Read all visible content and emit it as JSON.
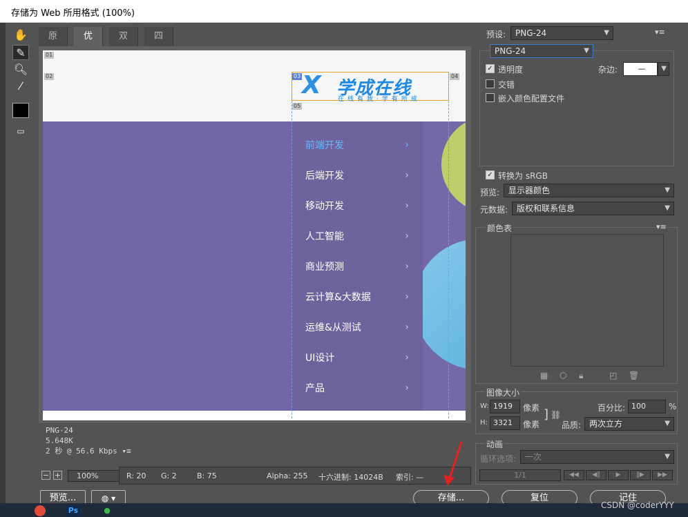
{
  "window": {
    "title": "存储为 Web 所用格式 (100%)"
  },
  "tabs": [
    {
      "label": "原稿"
    },
    {
      "label": "优化"
    },
    {
      "label": "双联"
    },
    {
      "label": "四联"
    }
  ],
  "canvas": {
    "slices": [
      "01",
      "02",
      "03",
      "04",
      "05"
    ],
    "logo": {
      "main": "学成在线",
      "sub": "在线有我·学有所成"
    },
    "menu": [
      "前端开发",
      "后端开发",
      "移动开发",
      "人工智能",
      "商业预测",
      "云计算&大数据",
      "运维&从测试",
      "UI设计",
      "产品"
    ],
    "chevron": "›"
  },
  "info": {
    "format": "PNG-24",
    "size": "5.648K",
    "speed": "2 秒 @ 56.6 Kbps",
    "menu_glyph": "▾≡"
  },
  "status": {
    "zoom": "100%",
    "r": "R: 20",
    "g": "G: 2",
    "b": "B: 75",
    "alpha": "Alpha: 255",
    "hex": "十六进制: 14024B",
    "index": "索引: —"
  },
  "buttons": {
    "preview": "预览...",
    "save": "存储...",
    "reset": "复位",
    "remember": "记住"
  },
  "settings": {
    "preset_label": "预设:",
    "preset_value": "PNG-24",
    "format_value": "PNG-24",
    "transparency": "透明度",
    "matte_label": "杂边:",
    "matte_value": "—",
    "interlaced": "交错",
    "embed_profile": "嵌入颜色配置文件",
    "convert_srgb": "转换为 sRGB",
    "preview_label": "预览:",
    "preview_value": "显示器颜色",
    "metadata_label": "元数据:",
    "metadata_value": "版权和联系信息"
  },
  "color_table": {
    "label": "颜色表"
  },
  "image_size": {
    "label": "图像大小",
    "w_label": "W:",
    "w_value": "1919",
    "h_label": "H:",
    "h_value": "3321",
    "unit": "像素",
    "percent_label": "百分比:",
    "percent_value": "100",
    "percent_unit": "%",
    "quality_label": "品质:",
    "quality_value": "两次立方"
  },
  "animation": {
    "label": "动画",
    "loop_label": "循环选项:",
    "loop_value": "一次",
    "frame": "1/1"
  },
  "watermark": "CSDN @coderYYY",
  "colors": {
    "panel": "#535353",
    "purple": "#7366a6",
    "menu": "#6e639c",
    "accent_blue": "#66b6ff",
    "logo_blue": "#1e88e5"
  }
}
